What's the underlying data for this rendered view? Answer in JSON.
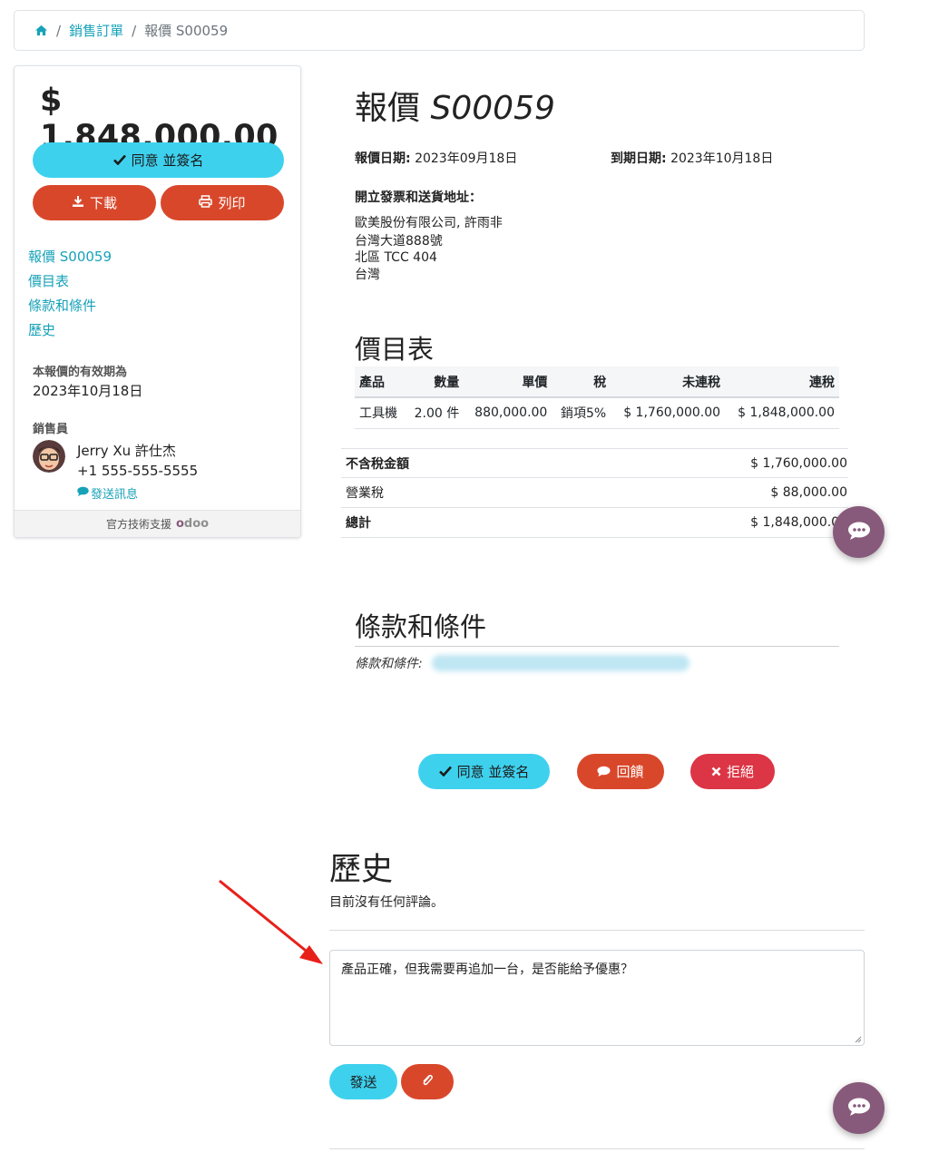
{
  "breadcrumb": {
    "link": "銷售訂單",
    "current": "報價 S00059"
  },
  "sidebar": {
    "amount": "$ 1,848,000.00",
    "accept_label": "同意 並簽名",
    "download_label": "下載",
    "print_label": "列印",
    "nav": [
      "報價 S00059",
      "價目表",
      "條款和條件",
      "歷史"
    ],
    "validity_label": "本報價的有效期為",
    "validity_value": "2023年10月18日",
    "salesperson_label": "銷售員",
    "salesperson_name": "Jerry Xu 許仕杰",
    "salesperson_phone": "+1 555-555-5555",
    "send_message": "發送訊息",
    "footer_text": "官方技術支援",
    "footer_logo": "odoo"
  },
  "quote": {
    "title_prefix": "報價",
    "title_number": "S00059",
    "date_label": "報價日期:",
    "date_value": "2023年09月18日",
    "expiry_label": "到期日期:",
    "expiry_value": "2023年10月18日",
    "address_heading": "開立發票和送貨地址：",
    "address_lines": [
      "歐美股份有限公司, 許雨非",
      "台灣大道888號",
      "北區 TCC 404",
      "台灣"
    ]
  },
  "pricelist": {
    "title": "價目表",
    "headers": [
      "產品",
      "數量",
      "單價",
      "稅",
      "未連稅",
      "連稅"
    ],
    "rows": [
      [
        "工具機",
        "2.00 件",
        "880,000.00",
        "銷項5%",
        "$ 1,760,000.00",
        "$ 1,848,000.00"
      ]
    ]
  },
  "totals": [
    {
      "label": "不含稅金額",
      "value": "$ 1,760,000.00"
    },
    {
      "label": "營業稅",
      "value": "$ 88,000.00"
    },
    {
      "label": "總計",
      "value": "$ 1,848,000.00"
    }
  ],
  "terms": {
    "title": "條款和條件",
    "text": "條款和條件:"
  },
  "actions": {
    "accept_label": "同意 並簽名",
    "feedback_label": "回饋",
    "reject_label": "拒絕"
  },
  "history": {
    "title": "歷史",
    "empty_text": "目前沒有任何評論。",
    "comment_value": "產品正確，但我需要再追加一台，是否能給予優惠？",
    "send_label": "發送"
  },
  "colors": {
    "accent": "#3ed1ee",
    "danger": "#d9472b",
    "reject": "#dc3545",
    "link": "#17a2b8",
    "chat": "#875a7b",
    "arrow": "#e8201a"
  }
}
